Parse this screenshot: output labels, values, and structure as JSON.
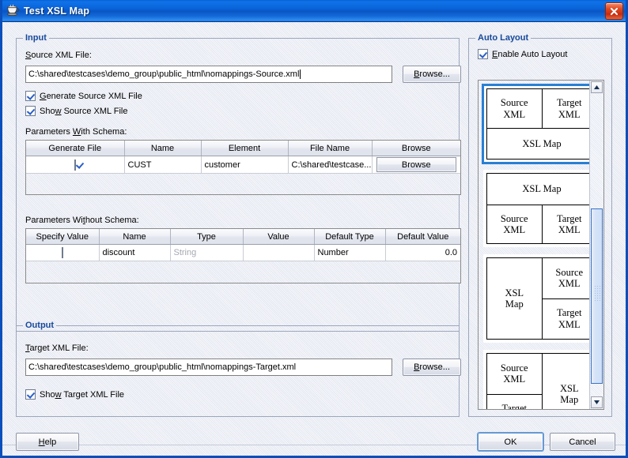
{
  "window": {
    "title": "Test XSL Map",
    "icon": "coffee-cup-icon",
    "close_label": "×"
  },
  "input_group": {
    "legend": "Input",
    "source_label": "Source XML File:",
    "source_label_mnemonic": "S",
    "source_value": "C:\\shared\\testcases\\demo_group\\public_html\\nomappings-Source.xml",
    "browse_label": "Browse...",
    "checkboxes": [
      {
        "label": "Generate Source XML File",
        "mnemonic": "G",
        "checked": true
      },
      {
        "label": "Show Source XML File",
        "mnemonic": "w",
        "checked": true
      }
    ],
    "with_schema": {
      "label": "Parameters With Schema:",
      "label_mnemonic": "W",
      "columns": [
        "Generate File",
        "Name",
        "Element",
        "File Name",
        "Browse"
      ],
      "rows": [
        {
          "generate_file": true,
          "name": "CUST",
          "element": "customer",
          "file_name": "C:\\shared\\testcase...",
          "browse": "Browse"
        }
      ]
    },
    "without_schema": {
      "label": "Parameters Without Schema:",
      "label_mnemonic": "t",
      "columns": [
        "Specify Value",
        "Name",
        "Type",
        "Value",
        "Default Type",
        "Default Value"
      ],
      "rows": [
        {
          "specify_value": false,
          "name": "discount",
          "type": "String",
          "type_muted": true,
          "value": "",
          "default_type": "Number",
          "default_value": "0.0"
        }
      ]
    }
  },
  "output_group": {
    "legend": "Output",
    "target_label": "Target XML File:",
    "target_label_mnemonic": "T",
    "target_value": "C:\\shared\\testcases\\demo_group\\public_html\\nomappings-Target.xml",
    "browse_label": "Browse...",
    "checkbox": {
      "label": "Show Target XML File",
      "mnemonic": "w",
      "checked": true
    }
  },
  "auto_layout": {
    "legend": "Auto Layout",
    "enable_label": "Enable Auto Layout",
    "enable_mnemonic": "E",
    "enable_checked": true,
    "labels": {
      "source": "Source\nXML",
      "target": "Target\nXML",
      "map": "XSL Map"
    },
    "options": [
      {
        "id": "layout-source-target-over-map",
        "selected": true,
        "top_left": "Source XML",
        "top_right": "Target XML",
        "bottom": "XSL Map"
      },
      {
        "id": "layout-map-over-source-target",
        "selected": false,
        "top": "XSL Map",
        "bottom_left": "Source XML",
        "bottom_right": "Target XML"
      },
      {
        "id": "layout-map-left-source-target-right",
        "selected": false,
        "left": "XSL Map",
        "right_top": "Source XML",
        "right_bottom": "Target XML"
      },
      {
        "id": "layout-source-target-left-map-right",
        "selected": false,
        "left_top": "Source XML",
        "left_bottom": "Target XML",
        "right": "XSL Map"
      }
    ],
    "scroll": {
      "up_arrow": "▲",
      "down_arrow": "▼"
    }
  },
  "footer": {
    "help_label": "Help",
    "help_mnemonic": "H",
    "ok_label": "OK",
    "cancel_label": "Cancel"
  },
  "colors": {
    "title_bar_blue": "#0a62d8",
    "group_title_blue": "#16499b",
    "selection_blue": "#2a7fd4",
    "close_red": "#c62c11",
    "check_blue": "#2a5fc9"
  }
}
